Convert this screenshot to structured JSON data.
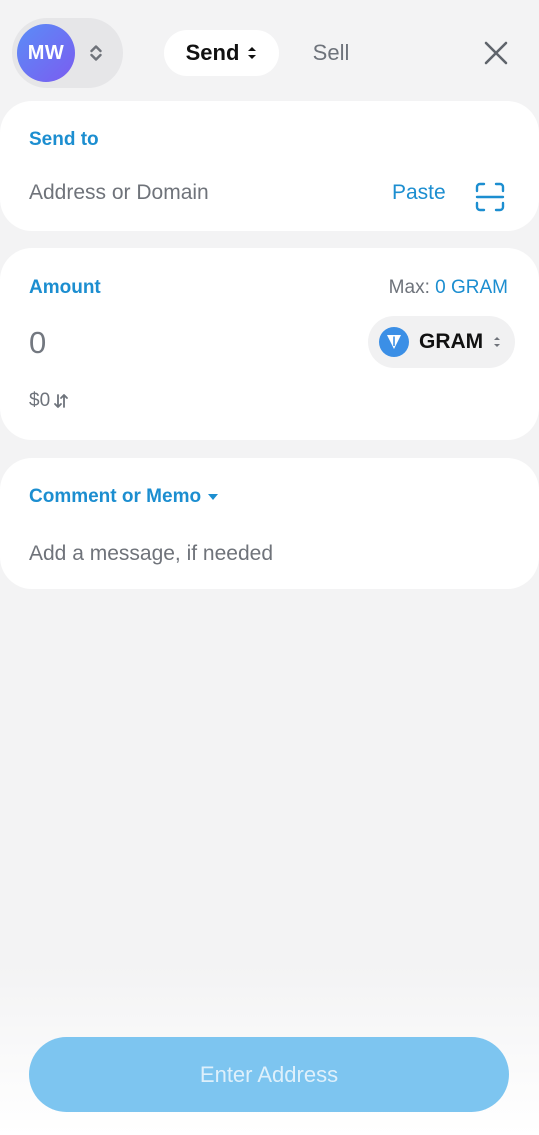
{
  "header": {
    "avatar_initials": "MW",
    "tabs": [
      {
        "label": "Send",
        "selected": true
      },
      {
        "label": "Sell",
        "selected": false
      }
    ]
  },
  "send_to": {
    "label": "Send to",
    "input_placeholder": "Address or Domain",
    "input_value": "",
    "paste_label": "Paste",
    "scan_icon": "qr-scan-icon"
  },
  "amount": {
    "label": "Amount",
    "max_prefix": "Max:",
    "max_value": "0 GRAM",
    "value": "0",
    "token": {
      "label": "GRAM",
      "icon": "gram-diamond-icon"
    },
    "fiat_value": "$0"
  },
  "memo": {
    "label": "Comment or Memo",
    "input_placeholder": "Add a message, if needed",
    "input_value": ""
  },
  "submit": {
    "label": "Enter Address",
    "enabled": false
  },
  "colors": {
    "accent": "#1c8ed0",
    "background": "#f3f3f4",
    "submit_disabled": "#7dc5f0"
  }
}
